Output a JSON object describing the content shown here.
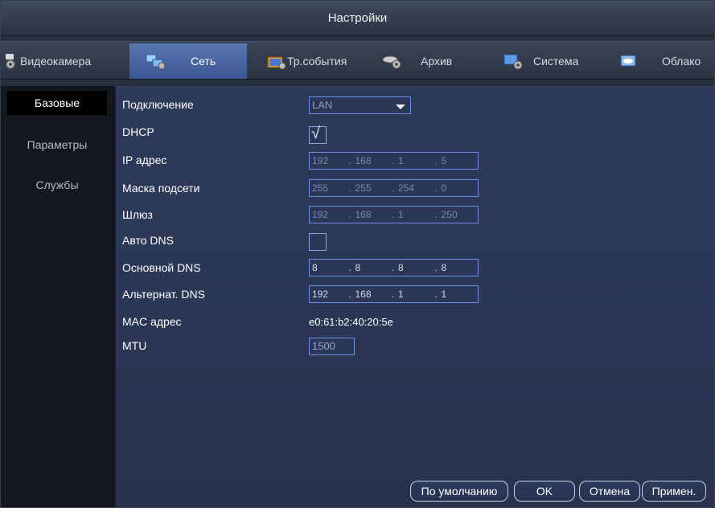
{
  "window": {
    "title": "Настройки"
  },
  "tabs": [
    {
      "label": "Видеокамера",
      "icon": "camera-gear-icon",
      "active": false
    },
    {
      "label": "Сеть",
      "icon": "network-icon",
      "active": true
    },
    {
      "label": "Тр.события",
      "icon": "alarm-event-icon",
      "active": false
    },
    {
      "label": "Архив",
      "icon": "storage-gear-icon",
      "active": false
    },
    {
      "label": "Система",
      "icon": "system-gear-icon",
      "active": false
    },
    {
      "label": "Облако",
      "icon": "cloud-icon",
      "active": false
    }
  ],
  "sidebar": {
    "items": [
      {
        "label": "Базовые",
        "active": true
      },
      {
        "label": "Параметры",
        "active": false
      },
      {
        "label": "Службы",
        "active": false
      }
    ]
  },
  "form": {
    "connection": {
      "label": "Подключение",
      "value": "LAN"
    },
    "dhcp": {
      "label": "DHCP",
      "checked": true,
      "mark": "√"
    },
    "ip": {
      "label": "IP адрес",
      "octets": [
        "192",
        "168",
        "1",
        "5"
      ]
    },
    "mask": {
      "label": "Маска подсети",
      "octets": [
        "255",
        "255",
        "254",
        "0"
      ]
    },
    "gateway": {
      "label": "Шлюз",
      "octets": [
        "192",
        "168",
        "1",
        "250"
      ]
    },
    "auto_dns": {
      "label": "Авто DNS",
      "checked": false
    },
    "dns1": {
      "label": "Основной DNS",
      "octets": [
        "8",
        "8",
        "8",
        "8"
      ]
    },
    "dns2": {
      "label": "Альтернат. DNS",
      "octets": [
        "192",
        "168",
        "1",
        "1"
      ]
    },
    "mac": {
      "label": "MAC адрес",
      "value": "e0:61:b2:40:20:5e"
    },
    "mtu": {
      "label": "MTU",
      "value": "1500"
    }
  },
  "buttons": {
    "default": "По умолчанию",
    "ok": "OK",
    "cancel": "Отмена",
    "apply": "Примен."
  },
  "colors": {
    "accent_tab": "#4a66a4",
    "field_border": "#6f8fe0",
    "panel_bg": "#2d3a5a"
  }
}
